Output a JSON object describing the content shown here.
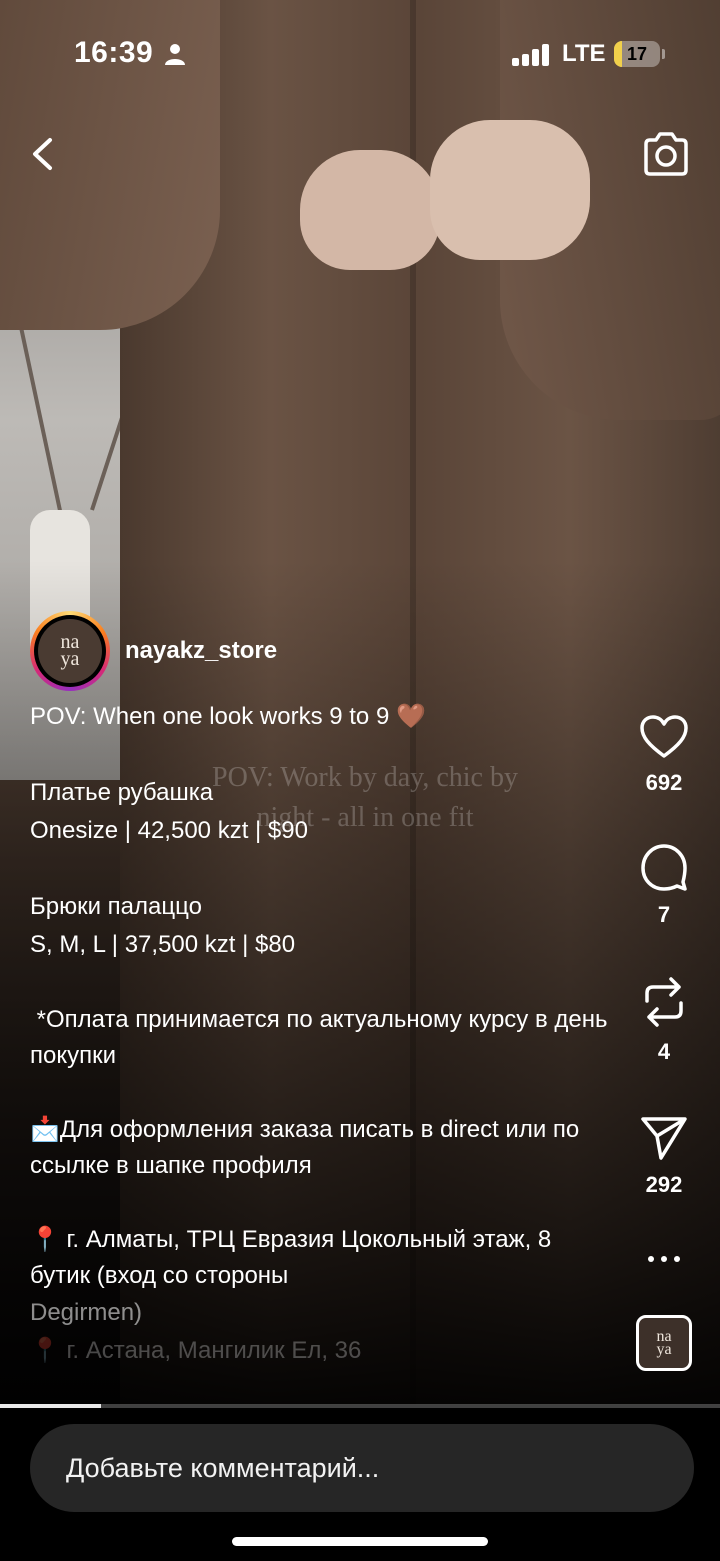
{
  "status_bar": {
    "time": "16:39",
    "network": "LTE",
    "battery_level": "17",
    "battery_percent": 17,
    "battery_color": "#f1d04b",
    "signal_bars_active": 4
  },
  "post": {
    "username": "nayakz_store",
    "avatar_text_top": "na",
    "avatar_text_bottom": "ya",
    "overlay_text": "POV: Work by day, chic by night - all in one fit",
    "caption": {
      "line_1": "POV: When one look works 9 to 9 🤎",
      "line_2": "Платье рубашка",
      "line_3": "Onesize | 42,500 kzt | $90",
      "line_4": "Брюки палаццо",
      "line_5": "S, M, L | 37,500 kzt | $80",
      "line_6": " *Оплата принимается по актуальному курсу в день покупки",
      "line_7": "📩Для оформления заказа писать в direct или по ссылке в шапке профиля",
      "line_8": "📍 г. Алматы, ТРЦ Евразия Цокольный этаж, 8 бутик (вход со стороны",
      "line_9": "Degirmen)",
      "line_10": "📍 г. Астана, Мангилик Ел, 36"
    }
  },
  "actions": {
    "likes": "692",
    "comments": "7",
    "reposts": "4",
    "shares": "292",
    "like_icon": "heart-icon",
    "comment_icon": "comment-bubble-icon",
    "repost_icon": "repost-icon",
    "share_icon": "paper-plane-icon",
    "more_icon": "more-dots-icon"
  },
  "playback_progress": 0.14,
  "comment_input": {
    "placeholder": "Добавьте комментарий..."
  },
  "colors": {
    "accent_ring": [
      "#feda75",
      "#fa7e1e",
      "#d62976",
      "#962fbf"
    ],
    "comment_box_bg": "#262626"
  }
}
